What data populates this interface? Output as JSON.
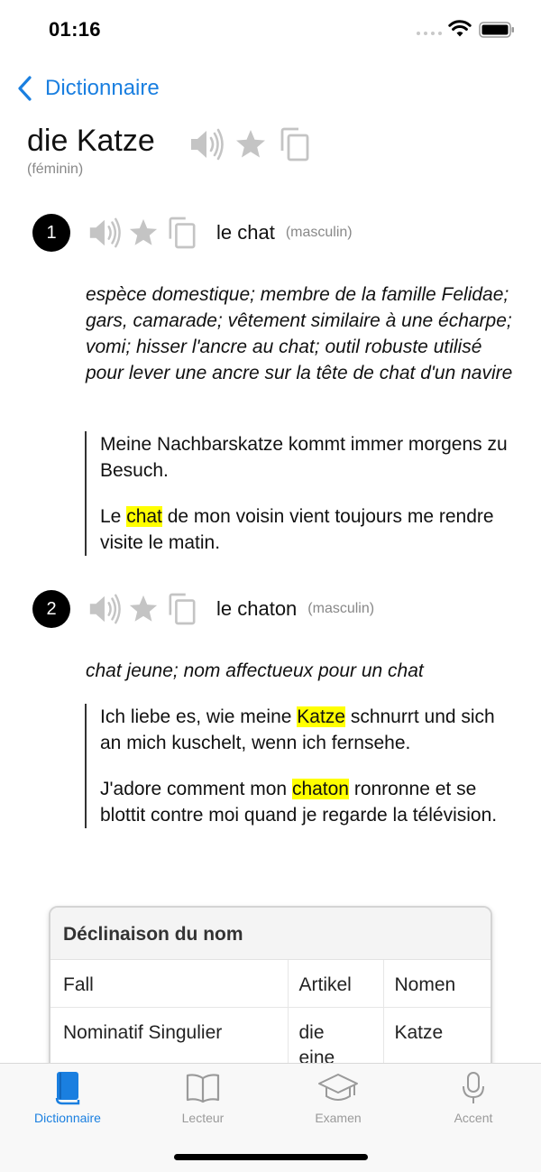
{
  "status_bar": {
    "time": "01:16"
  },
  "nav": {
    "back_label": "Dictionnaire"
  },
  "entry": {
    "headword": "die Katze",
    "gender": "(féminin)",
    "senses": [
      {
        "number": "1",
        "term": "le chat",
        "gender": "(masculin)",
        "definition": "espèce domestique; membre de la famille Felidae; gars, camarade; vêtement similaire à une écharpe; vomi; hisser l'ancre au chat; outil robuste utilisé pour lever une ancre sur la tête de chat d'un navire",
        "example_de": {
          "text": "Meine Nachbarskatze kommt immer morgens zu Besuch."
        },
        "example_fr": {
          "before": "Le ",
          "highlight": "chat",
          "after": " de mon voisin vient toujours me rendre visite le matin."
        }
      },
      {
        "number": "2",
        "term": "le chaton",
        "gender": "(masculin)",
        "definition": "chat jeune; nom affectueux pour un chat",
        "example_de": {
          "before": "Ich liebe es, wie meine ",
          "highlight": "Katze",
          "after": " schnurrt und sich an mich kuschelt, wenn ich fernsehe."
        },
        "example_fr": {
          "before": "J'adore comment mon ",
          "highlight": "chaton",
          "after": " ronronne et se blottit contre moi quand je regarde la télévision."
        }
      }
    ]
  },
  "declension": {
    "title": "Déclinaison du nom",
    "columns": [
      "Fall",
      "Artikel",
      "Nomen"
    ],
    "rows": [
      {
        "case": "Nominatif Singulier",
        "article_1": "die",
        "article_2": "eine",
        "noun": "Katze"
      }
    ]
  },
  "tabs": [
    {
      "label": "Dictionnaire",
      "icon": "book-icon",
      "active": true
    },
    {
      "label": "Lecteur",
      "icon": "open-book-icon",
      "active": false
    },
    {
      "label": "Examen",
      "icon": "graduation-cap-icon",
      "active": false
    },
    {
      "label": "Accent",
      "icon": "microphone-icon",
      "active": false
    }
  ],
  "colors": {
    "accent": "#1a7fe0",
    "highlight": "#ffff00",
    "icon_gray": "#c4c4c4",
    "tab_inactive": "#9a9a9a"
  }
}
